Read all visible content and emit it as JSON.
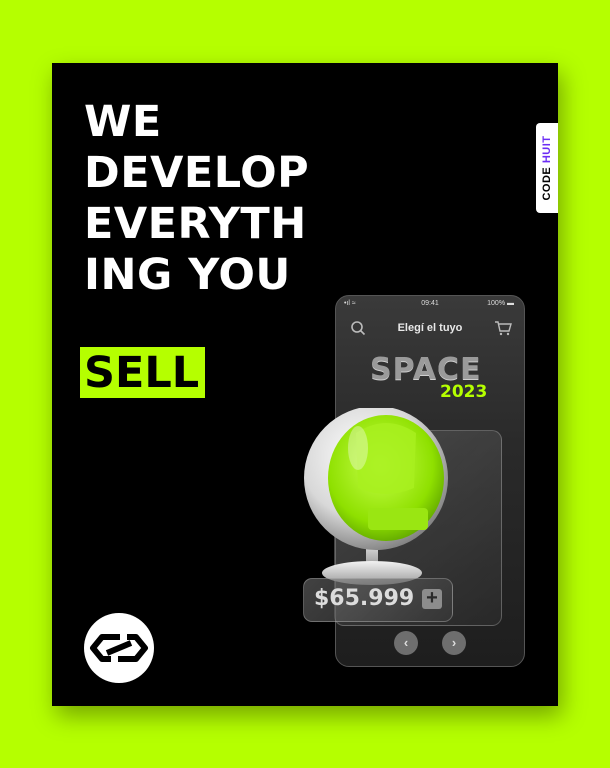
{
  "headline": {
    "lines": [
      "WE",
      "DEVELOP",
      "EVERYTH",
      "ING YOU"
    ],
    "highlight": "SELL"
  },
  "brand_tab": {
    "part1": "CODE",
    "part2": "HUIT"
  },
  "logo": {
    "icon": "infinity-loop-icon"
  },
  "phone": {
    "status": {
      "signal": "•ıl ≈",
      "time": "09:41",
      "battery": "100% ▬"
    },
    "title": "Elegí el tuyo",
    "banner_word": "SPACE",
    "banner_year": "2023",
    "price": "$65.999",
    "add_symbol": "+",
    "prev_symbol": "‹",
    "next_symbol": "›"
  },
  "colors": {
    "accent": "#b5ff00",
    "background": "#000000",
    "brand_purple": "#6b2cf5"
  }
}
